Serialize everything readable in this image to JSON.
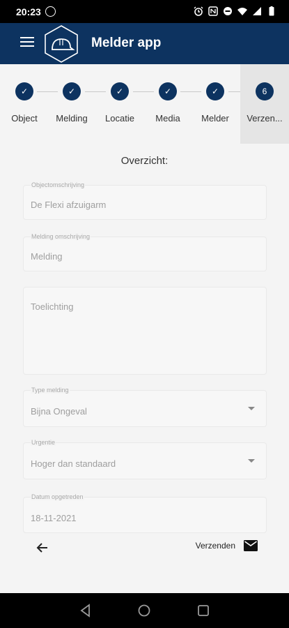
{
  "status_bar": {
    "time": "20:23"
  },
  "app_bar": {
    "title": "Melder app"
  },
  "stepper": {
    "steps": [
      {
        "label": "Object",
        "state": "done",
        "marker": "✓"
      },
      {
        "label": "Melding",
        "state": "done",
        "marker": "✓"
      },
      {
        "label": "Locatie",
        "state": "done",
        "marker": "✓"
      },
      {
        "label": "Media",
        "state": "done",
        "marker": "✓"
      },
      {
        "label": "Melder",
        "state": "done",
        "marker": "✓"
      },
      {
        "label": "Verzen...",
        "state": "active",
        "marker": "6"
      }
    ]
  },
  "overview": {
    "title": "Overzicht:"
  },
  "form": {
    "object_description": {
      "label": "Objectomschrijving",
      "value": "De Flexi afzuigarm"
    },
    "report_description": {
      "label": "Melding omschrijving",
      "value": "Melding"
    },
    "explanation": {
      "placeholder": "Toelichting"
    },
    "report_type": {
      "label": "Type melding",
      "value": "Bijna Ongeval"
    },
    "urgency": {
      "label": "Urgentie",
      "value": "Hoger dan standaard"
    },
    "date_occurred": {
      "label": "Datum opgetreden",
      "value": "18-11-2021"
    }
  },
  "actions": {
    "send_label": "Verzenden"
  },
  "colors": {
    "primary": "#0d3360",
    "background": "#f4f4f4"
  },
  "icons": [
    "whatsapp-icon",
    "alarm-icon",
    "nfc-icon",
    "dnd-icon",
    "wifi-icon",
    "signal-icon",
    "battery-icon",
    "menu-icon",
    "helmet-logo-icon",
    "back-arrow-icon",
    "mail-icon",
    "nav-back-icon",
    "nav-home-icon",
    "nav-recents-icon"
  ]
}
